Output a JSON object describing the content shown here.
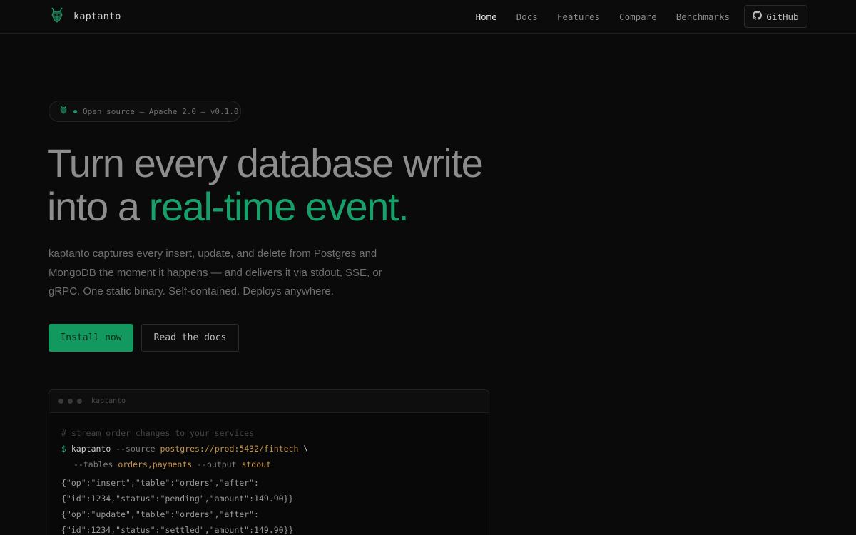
{
  "nav": {
    "brand": "kaptanto",
    "links": [
      "Home",
      "Docs",
      "Features",
      "Compare",
      "Benchmarks"
    ],
    "github_label": "GitHub"
  },
  "badge": {
    "text": "Open source — Apache 2.0 — v0.1.0"
  },
  "hero": {
    "title_line1": "Turn every database write",
    "title_line2_prefix": "into a ",
    "title_line2_accent": "real-time event.",
    "description": "kaptanto captures every insert, update, and delete from Postgres and MongoDB the moment it happens — and delivers it via stdout, SSE, or gRPC. One static binary. Self-contained. Deploys anywhere.",
    "primary_button": "Install now",
    "secondary_button": "Read the docs"
  },
  "terminal": {
    "title": "kaptanto",
    "comment": "# stream order changes to your services",
    "prompt": "$",
    "cmd": "kaptanto",
    "flag_source": "--source",
    "source_value": "postgres://prod:5432/fintech",
    "continuation": "\\",
    "flag_tables": "--tables",
    "tables_value": "orders,payments",
    "flag_output": "--output",
    "output_value": "stdout",
    "output_lines": [
      "{\"op\":\"insert\",\"table\":\"orders\",\"after\":",
      "{\"id\":1234,\"status\":\"pending\",\"amount\":149.90}}",
      "{\"op\":\"update\",\"table\":\"orders\",\"after\":",
      "{\"id\":1234,\"status\":\"settled\",\"amount\":149.90}}"
    ]
  },
  "colors": {
    "accent": "#18a06a",
    "background": "#0a0a0a",
    "value": "#c8954a"
  }
}
